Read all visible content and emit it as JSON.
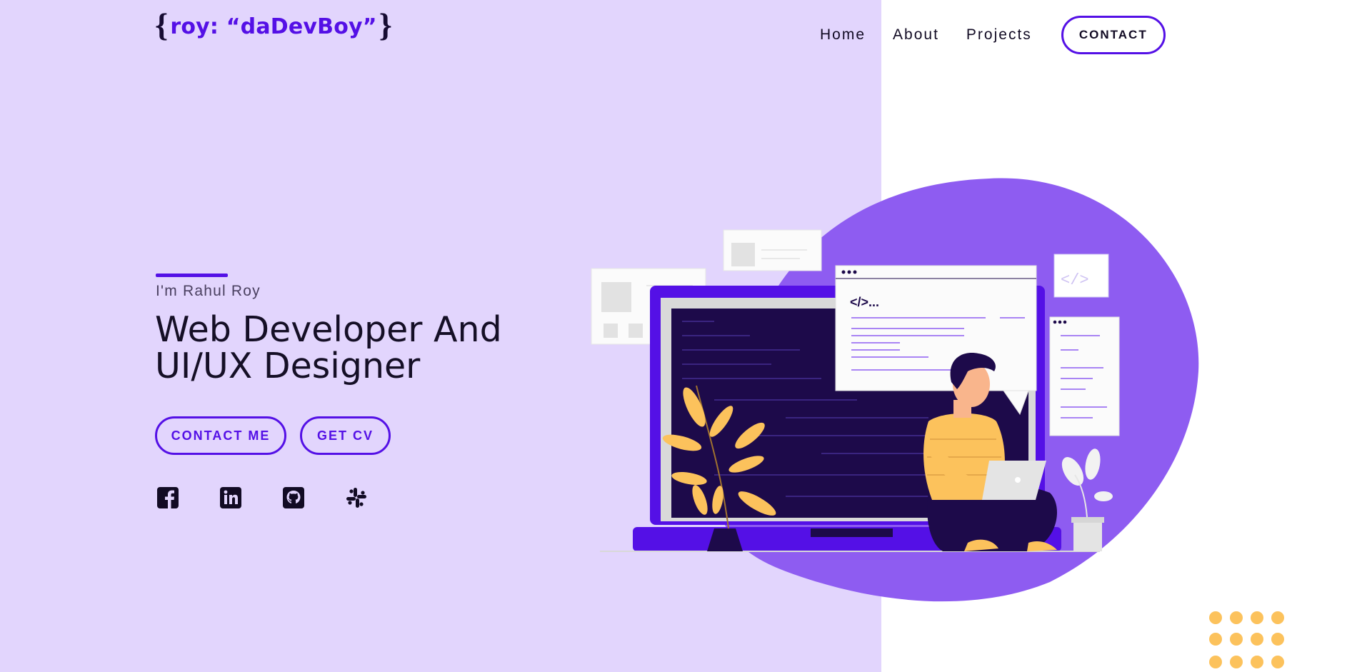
{
  "header": {
    "logo": {
      "brace_open": "{",
      "text": "roy: “daDevBoy”",
      "brace_close": "}"
    },
    "nav": [
      {
        "label": "Home"
      },
      {
        "label": "About"
      },
      {
        "label": "Projects"
      }
    ],
    "contact_label": "CONTACT"
  },
  "hero": {
    "intro": "I'm Rahul Roy",
    "title_line1": "Web Developer And",
    "title_line2": "UI/UX Designer",
    "buttons": {
      "contact_me": "CONTACT ME",
      "get_cv": "GET CV"
    },
    "socials": [
      {
        "icon": "facebook-icon"
      },
      {
        "icon": "linkedin-icon"
      },
      {
        "icon": "github-icon"
      },
      {
        "icon": "slack-icon"
      }
    ]
  },
  "illustration": {
    "code_tag": "</>..."
  },
  "colors": {
    "left_bg": "#e2d5fd",
    "accent": "#5410e6",
    "blob": "#8e5cf1",
    "laptop": "#5410e6",
    "screen": "#1d0a4a",
    "yellow": "#fcc25c"
  }
}
